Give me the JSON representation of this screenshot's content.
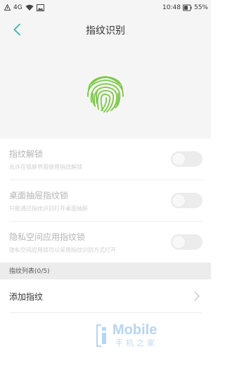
{
  "status_bar": {
    "network": "4G",
    "time": "10:48",
    "battery": "55%"
  },
  "header": {
    "title": "指纹识别",
    "back_icon": "chevron-left-icon",
    "accent_color": "#2bb5a2"
  },
  "hero": {
    "icon": "fingerprint-icon",
    "icon_color": "#7ac943"
  },
  "settings": [
    {
      "label": "指纹解锁",
      "description": "允许在锁屏界面使用指纹解锁",
      "enabled": false
    },
    {
      "label": "桌面抽屉指纹锁",
      "description": "只能通过指纹识别打开桌面抽屉",
      "enabled": false
    },
    {
      "label": "隐私空间应用指纹锁",
      "description": "隐私空间应用锁可以采用指纹识别方式打开",
      "enabled": false
    }
  ],
  "fingerprint_list": {
    "header": "指纹列表(0/5)",
    "add_label": "添加指纹"
  },
  "watermark": {
    "logo_text": "Mobile",
    "sub_text": "手机之家"
  }
}
